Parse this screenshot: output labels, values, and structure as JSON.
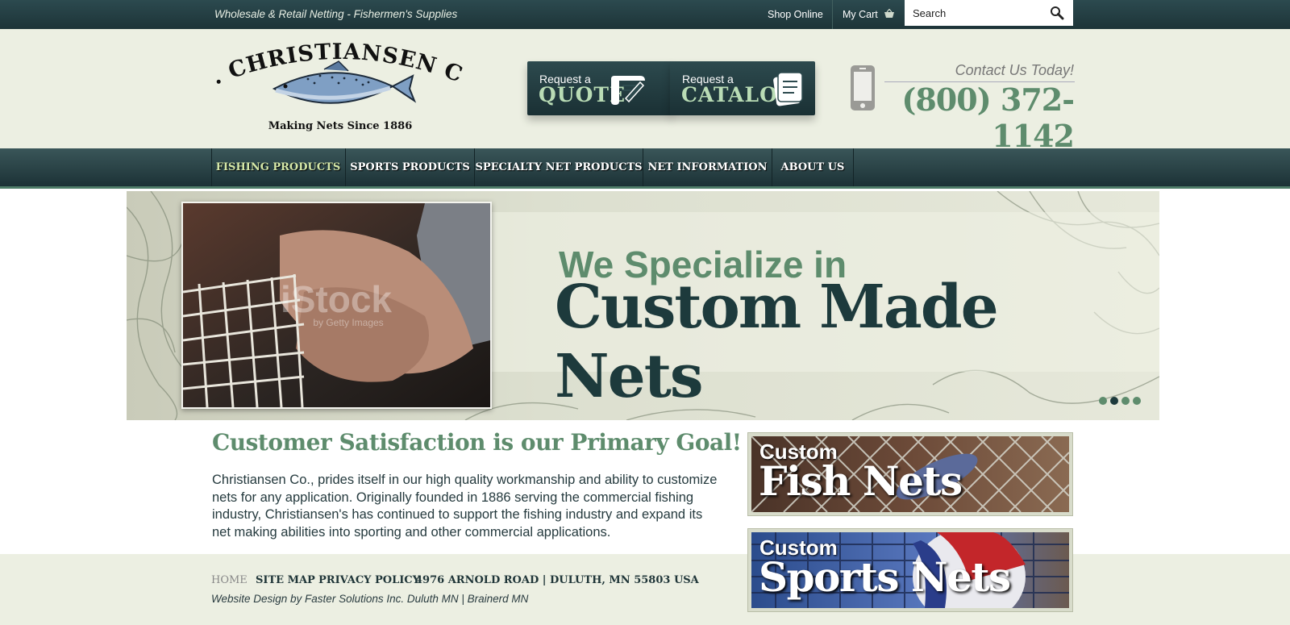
{
  "topbar": {
    "tagline": "Wholesale & Retail Netting  -  Fishermen's Supplies",
    "shop_online": "Shop Online",
    "my_cart": "My Cart",
    "search_placeholder": "Search"
  },
  "header": {
    "logo_name": "H. CHRISTIANSEN CO.",
    "logo_tagline": "Making Nets Since 1886",
    "quote": {
      "small": "Request a",
      "big": "QUOTE"
    },
    "catalog": {
      "small": "Request a",
      "big": "CATALOG"
    },
    "contact_label": "Contact Us Today!",
    "phone": "(800) 372-1142"
  },
  "nav": {
    "items": [
      {
        "label": "FISHING PRODUCTS"
      },
      {
        "label": "SPORTS PRODUCTS"
      },
      {
        "label": "SPECIALTY NET PRODUCTS"
      },
      {
        "label": "NET INFORMATION"
      },
      {
        "label": "ABOUT US"
      }
    ]
  },
  "hero": {
    "subtitle": "We Specialize in",
    "title": "Custom Made Nets",
    "watermark": "iStock",
    "watermark_sub": "by Getty Images",
    "active_slide": 2,
    "slide_count": 4
  },
  "content": {
    "title": "Customer Satisfaction is our Primary Goal!",
    "body": "Christiansen Co., prides itself in our high quality workmanship and ability to customize nets for any application. Originally founded in 1886 serving the commercial fishing industry, Christiansen's has continued to support the fishing industry and expand its net making abilities into sporting and other commercial applications."
  },
  "promos": [
    {
      "small": "Custom",
      "big": "Fish Nets"
    },
    {
      "small": "Custom",
      "big": "Sports Nets"
    }
  ],
  "footer": {
    "links": [
      {
        "label": "HOME"
      },
      {
        "label": "SITE MAP"
      },
      {
        "label": "PRIVACY POLICY"
      },
      {
        "label": "4976 ARNOLD ROAD | DULUTH, MN 55803 USA"
      }
    ],
    "credit": "Website Design by Faster Solutions Inc. Duluth MN | Brainerd MN"
  },
  "colors": {
    "dark_teal": "#1d3438",
    "green_accent": "#5e8c6d",
    "header_bg": "#ecefe2"
  }
}
